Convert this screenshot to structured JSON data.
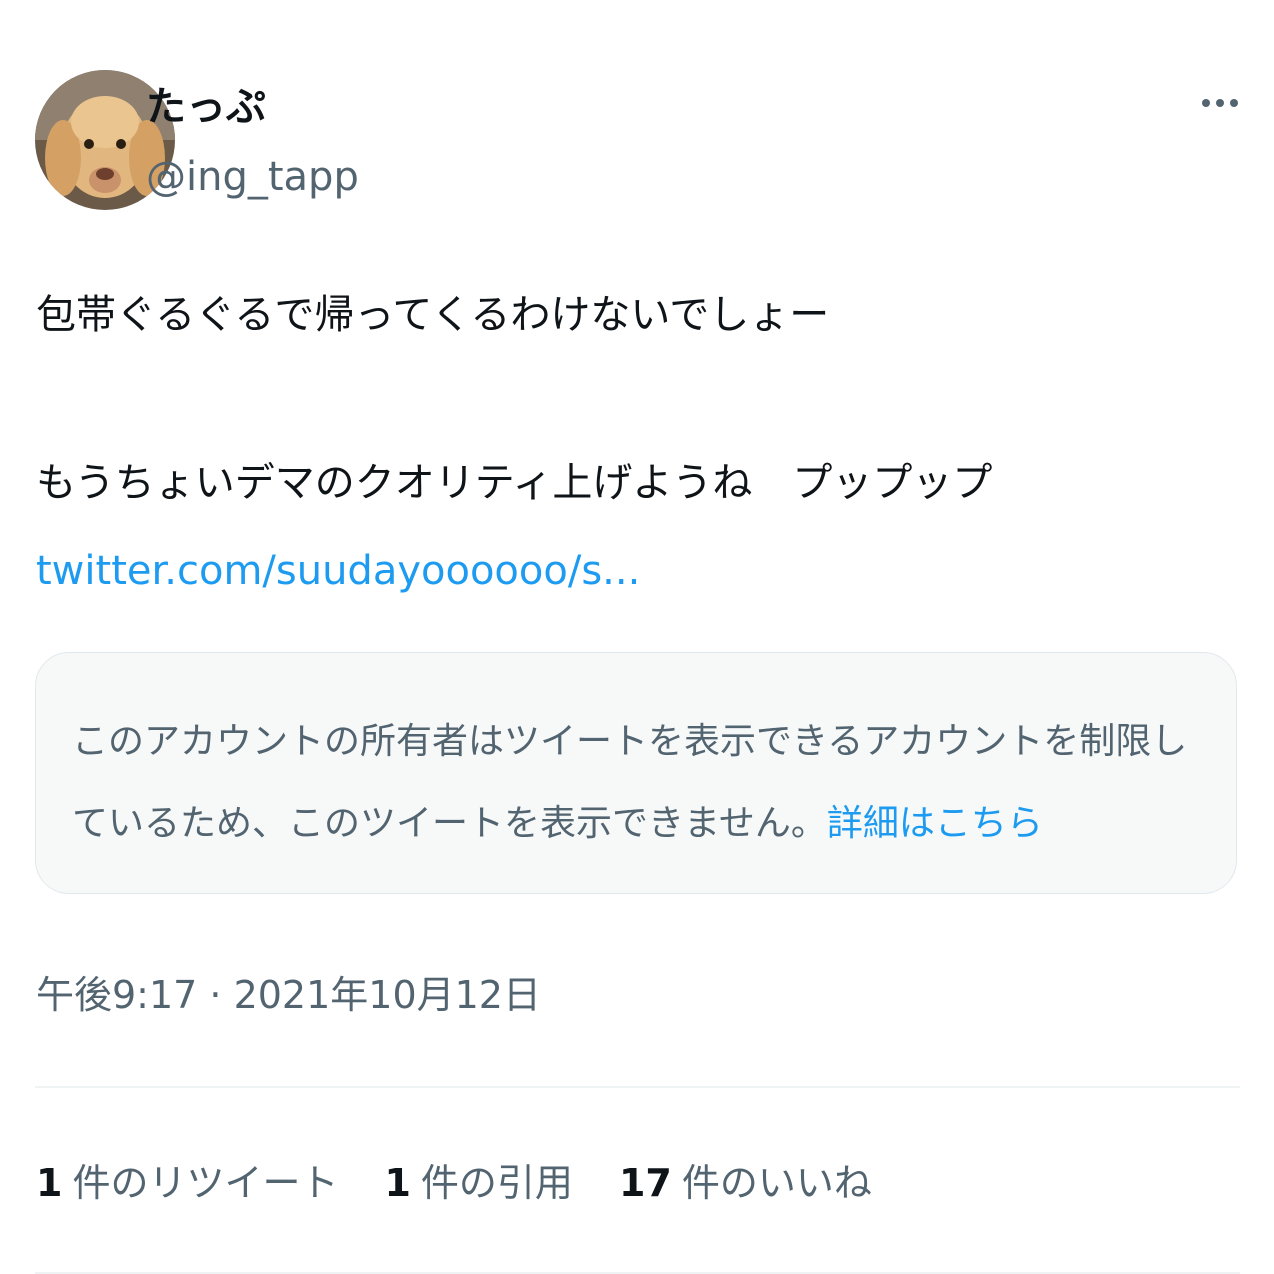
{
  "tweet": {
    "author": {
      "display_name": "たっぷ",
      "handle": "@ing_tapp",
      "avatar_icon": "dog-avatar-icon"
    },
    "more_icon": "more-horizontal-icon",
    "text_lines": [
      "包帯ぐるぐるで帰ってくるわけないでしょー",
      "もうちょいデマのクオリティ上げようね　プップップ"
    ],
    "link": "twitter.com/suudayoooooo/s...",
    "quoted_notice": {
      "text": "このアカウントの所有者はツイートを表示できるアカウントを制限しているため、このツイートを表示できません。",
      "link_label": "詳細はこちら"
    },
    "timestamp": "午後9:17 · 2021年10月12日",
    "stats": {
      "retweets": {
        "count": "1",
        "label": "件のリツイート"
      },
      "quotes": {
        "count": "1",
        "label": "件の引用"
      },
      "likes": {
        "count": "17",
        "label": "件のいいね"
      }
    }
  },
  "colors": {
    "link": "#1d9bf0",
    "secondary_text": "#536471",
    "notice_background": "#f7f9f9"
  }
}
